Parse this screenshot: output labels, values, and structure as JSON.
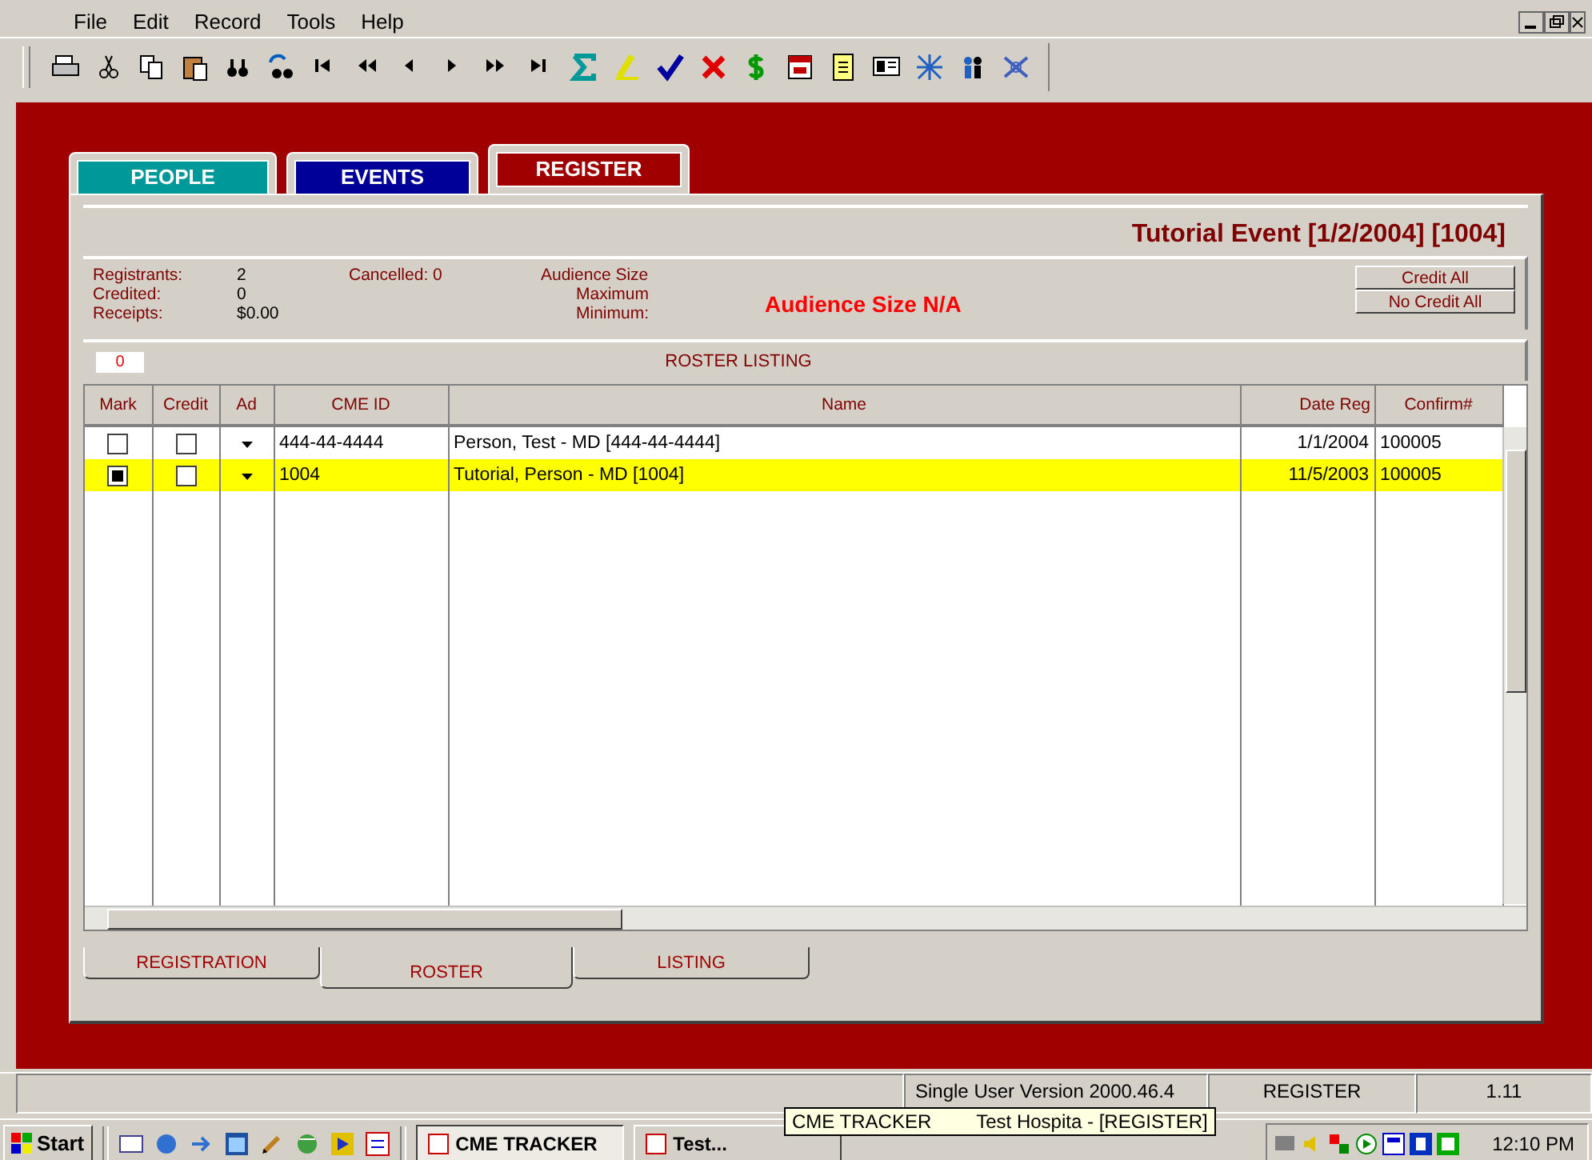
{
  "menu": [
    "File",
    "Edit",
    "Record",
    "Tools",
    "Help"
  ],
  "tabs": [
    {
      "label": "PEOPLE",
      "selected": false,
      "color": "#009999"
    },
    {
      "label": "EVENTS",
      "selected": false,
      "color": "#000099"
    },
    {
      "label": "REGISTER",
      "selected": true,
      "color": "#a00000"
    }
  ],
  "event_title": "Tutorial Event [1/2/2004] [1004]",
  "stats": [
    {
      "label": "Registrants:",
      "value": "2"
    },
    {
      "label": "Credited:",
      "value": "0"
    },
    {
      "label": "Receipts:",
      "value": "$0.00"
    }
  ],
  "cancelled": {
    "label": "Cancelled:",
    "value": "0"
  },
  "audience": {
    "label": "Audience Size",
    "maximum": "Maximum",
    "minimum": "Minimum:",
    "status": "Audience Size N/A"
  },
  "buttons": [
    "Credit All",
    "No Credit All"
  ],
  "roster": {
    "count": "0",
    "title": "ROSTER LISTING",
    "columns": [
      "Mark",
      "Credit",
      "Ad",
      "CME ID",
      "Name",
      "Date Reg",
      "Confirm#"
    ],
    "rows": [
      {
        "mark": false,
        "credit": false,
        "cme_id": "444-44-4444",
        "name": "Person, Test - MD [444-44-4444]",
        "date_reg": "1/1/2004",
        "confirm": "100005",
        "selected": false
      },
      {
        "mark": true,
        "credit": false,
        "cme_id": "1004",
        "name": "Tutorial, Person - MD [1004]",
        "date_reg": "11/5/2003",
        "confirm": "100005",
        "selected": true
      }
    ]
  },
  "bottom_tabs": [
    {
      "label": "REGISTRATION",
      "selected": false
    },
    {
      "label": "ROSTER",
      "selected": true
    },
    {
      "label": "LISTING",
      "selected": false
    }
  ],
  "status_bar": [
    "Single User Version 2000.46.4",
    "REGISTER",
    "1.11"
  ],
  "taskbar": {
    "start": "Start",
    "tasks": [
      {
        "label": "CME TRACKER",
        "selected": true
      },
      {
        "label": "Test...",
        "selected": false
      }
    ],
    "tooltip": [
      "CME TRACKER",
      "Test Hospita - [REGISTER]"
    ],
    "clock": "12:10 PM"
  }
}
